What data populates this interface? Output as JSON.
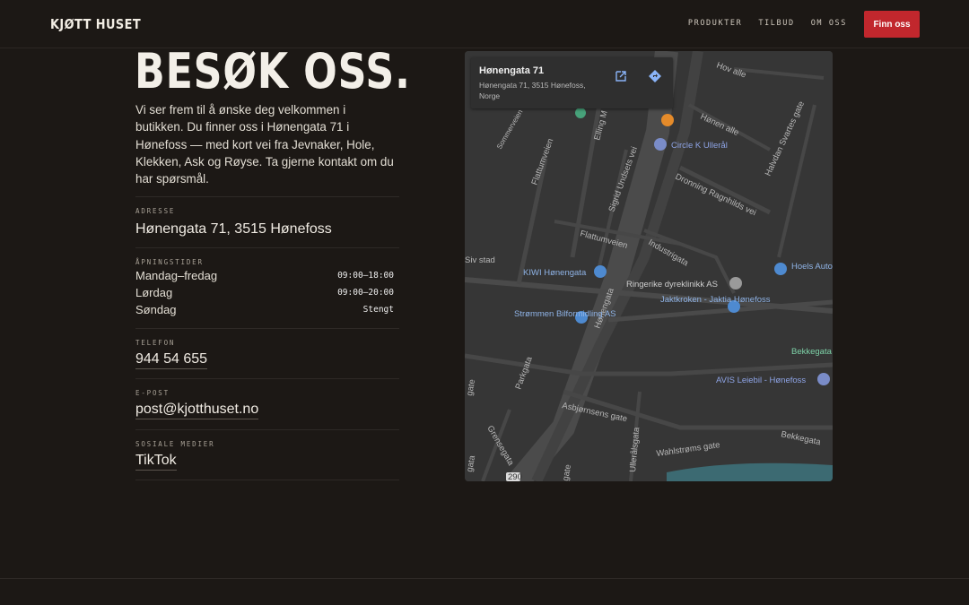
{
  "header": {
    "logo": "KJØTT HUSET",
    "nav": [
      "PRODUKTER",
      "TILBUD",
      "OM OSS"
    ],
    "cta": "Finn oss"
  },
  "colors": {
    "background": "#1c1815",
    "accent": "#c1272d",
    "text": "#e9e4dc"
  },
  "hero": {
    "title": "BESØK OSS.",
    "intro": "Vi ser frem til å ønske deg velkommen i butikken. Du finner oss i Hønengata 71 i Hønefoss — med kort vei fra Jevnaker, Hole, Klekken, Ask og Røyse. Ta gjerne kontakt om du har spørsmål."
  },
  "info": {
    "address": {
      "label": "ADRESSE",
      "value": "Hønengata 71, 3515 Hønefoss"
    },
    "hours": {
      "label": "ÅPNINGSTIDER",
      "rows": [
        {
          "day": "Mandag–fredag",
          "time": "09:00–18:00"
        },
        {
          "day": "Lørdag",
          "time": "09:00–20:00"
        },
        {
          "day": "Søndag",
          "time": "Stengt"
        }
      ]
    },
    "phone": {
      "label": "TELEFON",
      "value": "944 54 655"
    },
    "email": {
      "label": "E-POST",
      "value": "post@kjotthuset.no"
    },
    "social": {
      "label": "SOSIALE MEDIER",
      "value": "TikTok"
    }
  },
  "map": {
    "card_title": "Hønengata 71",
    "card_address": "Hønengata 71, 3515 Hønefoss, Norge",
    "open_icon": "open-external-icon",
    "directions_icon": "directions-icon",
    "places": [
      "Circle K Ullerål",
      "KIWI Hønengata",
      "Ringerike dyreklinikk AS",
      "Hoels Auto Bilverksted",
      "Jaktkroken - Jaktia Hønefoss",
      "Strømmen Bilformidling AS",
      "Bekkegata",
      "AVIS Leiebil - Hønefoss"
    ],
    "streets": [
      "Hov alle",
      "Sommerveien",
      "Flattumveien",
      "Elling M Solheims vei",
      "Hønen alle",
      "Halvdan Svartes gate",
      "Dronning Ragnhilds vei",
      "Sigrid Undsets vei",
      "Flattumveien",
      "Industrigata",
      "Hønengata",
      "Parkgata",
      "Asbjørnsens gate",
      "Ullerålsgata",
      "Wahlstrøms gate",
      "Bekkegata",
      "Grensegata",
      "Siv stad",
      "gate",
      "gata",
      "gate"
    ],
    "road_number": "290"
  }
}
